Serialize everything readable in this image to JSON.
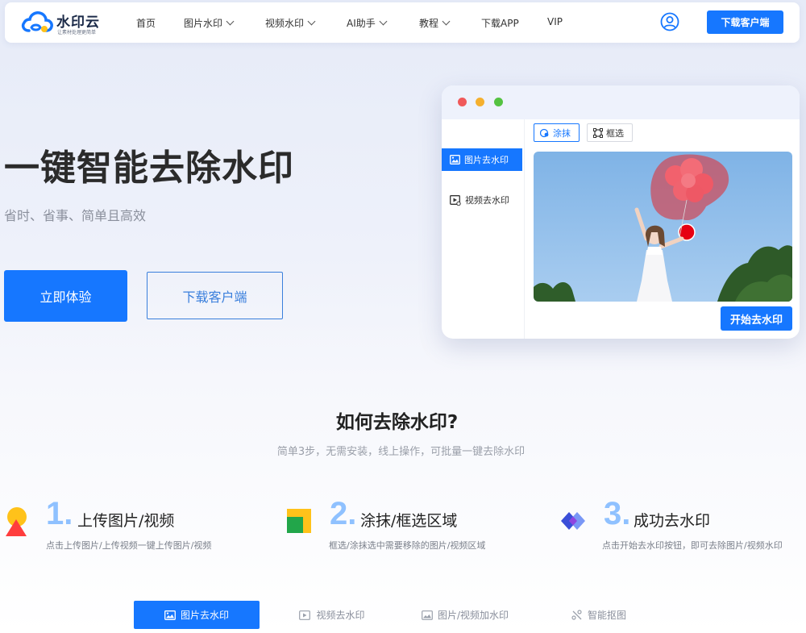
{
  "brand": {
    "name": "水印云",
    "slogan": "让素材处理更简单",
    "accent": "#1677ff"
  },
  "nav": {
    "items": [
      {
        "label": "首页",
        "dropdown": false
      },
      {
        "label": "图片水印",
        "dropdown": true
      },
      {
        "label": "视频水印",
        "dropdown": true
      },
      {
        "label": "AI助手",
        "dropdown": true
      },
      {
        "label": "教程",
        "dropdown": true
      },
      {
        "label": "下载APP",
        "dropdown": false
      },
      {
        "label": "VIP",
        "dropdown": false
      }
    ],
    "user_icon": "user-circle-icon",
    "download_label": "下载客户端"
  },
  "hero": {
    "title": "一键智能去除水印",
    "subtitle": "省时、省事、简单且高效",
    "primary_label": "立即体验",
    "secondary_label": "下载客户端"
  },
  "mock": {
    "sidebar": [
      {
        "label": "图片去水印",
        "icon": "image-icon",
        "active": true
      },
      {
        "label": "视频去水印",
        "icon": "video-icon",
        "active": false
      }
    ],
    "tools": [
      {
        "label": "涂抹",
        "icon": "brush-icon",
        "active": true
      },
      {
        "label": "框选",
        "icon": "box-select-icon",
        "active": false
      }
    ],
    "start_label": "开始去水印"
  },
  "how": {
    "title": "如何去除水印?",
    "subtitle": "简单3步，无需安装，线上操作，可批量一键去除水印",
    "steps": [
      {
        "num": "1.",
        "title": "上传图片/视频",
        "desc": "点击上传图片/上传视频一键上传图片/视频"
      },
      {
        "num": "2.",
        "title": "涂抹/框选区域",
        "desc": "框选/涂抹选中需要移除的图片/视频区域"
      },
      {
        "num": "3.",
        "title": "成功去水印",
        "desc": "点击开始去水印按钮，即可去除图片/视频水印"
      }
    ]
  },
  "tabs": [
    {
      "label": "图片去水印",
      "icon": "image-icon",
      "active": true
    },
    {
      "label": "视频去水印",
      "icon": "video-icon",
      "active": false
    },
    {
      "label": "图片/视频加水印",
      "icon": "image-icon",
      "active": false
    },
    {
      "label": "智能抠图",
      "icon": "cutout-icon",
      "active": false
    }
  ]
}
